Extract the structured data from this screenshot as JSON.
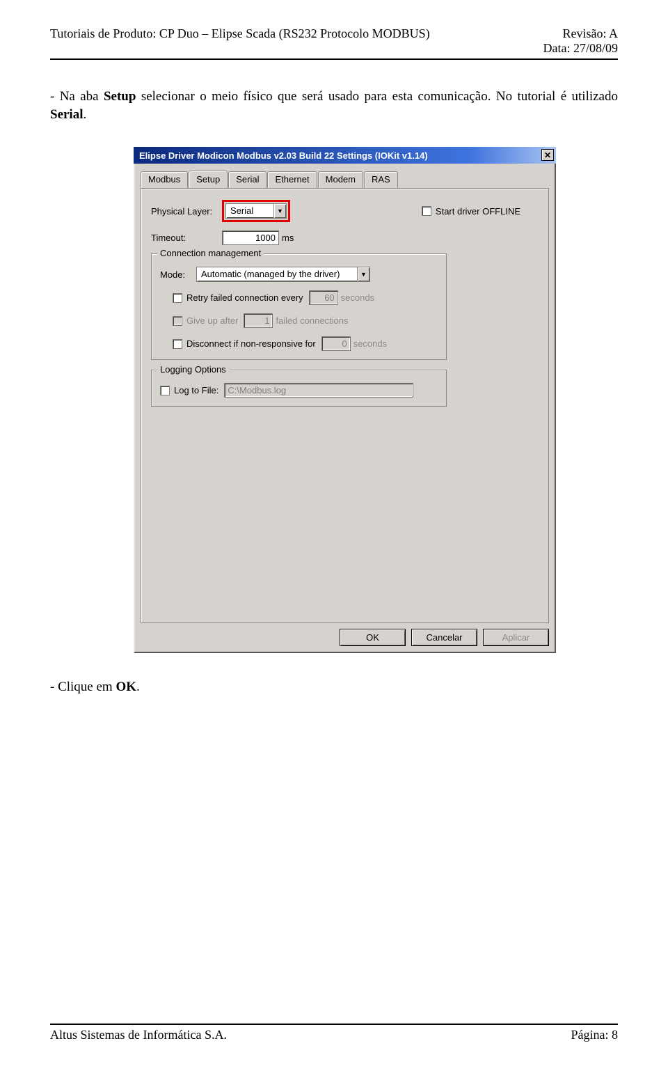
{
  "header": {
    "left": "Tutoriais de Produto: CP Duo – Elipse Scada (RS232 Protocolo MODBUS)",
    "right_rev": "Revisão: A",
    "right_date": "Data: 27/08/09"
  },
  "body": {
    "line1_pre": "-    Na aba ",
    "line1_b1": "Setup",
    "line1_mid": " selecionar o meio físico que será usado para esta comunicação. No tutorial é utilizado ",
    "line1_b2": "Serial",
    "line1_end": ".",
    "line2_pre": "-    Clique em ",
    "line2_b": "OK",
    "line2_end": "."
  },
  "dialog": {
    "title": "Elipse Driver Modicon Modbus v2.03 Build 22 Settings (IOKit v1.14)",
    "tabs": [
      "Modbus",
      "Setup",
      "Serial",
      "Ethernet",
      "Modem",
      "RAS"
    ],
    "active_tab": "Setup",
    "physical_layer_label": "Physical Layer:",
    "physical_layer_value": "Serial",
    "start_offline": "Start driver OFFLINE",
    "timeout_label": "Timeout:",
    "timeout_value": "1000",
    "timeout_unit": "ms",
    "conn_mgmt_legend": "Connection management",
    "mode_label": "Mode:",
    "mode_value": "Automatic (managed by the driver)",
    "retry_label": "Retry failed connection every",
    "retry_value": "60",
    "retry_unit": "seconds",
    "giveup_label": "Give up after",
    "giveup_value": "1",
    "giveup_unit": "failed connections",
    "disconnect_label": "Disconnect if non-responsive for",
    "disconnect_value": "0",
    "disconnect_unit": "seconds",
    "logging_legend": "Logging Options",
    "logfile_label": "Log to File:",
    "logfile_value": "C:\\Modbus.log",
    "buttons": {
      "ok": "OK",
      "cancel": "Cancelar",
      "apply": "Aplicar"
    }
  },
  "footer": {
    "left": "Altus Sistemas de Informática S.A.",
    "right": "Página: 8"
  }
}
